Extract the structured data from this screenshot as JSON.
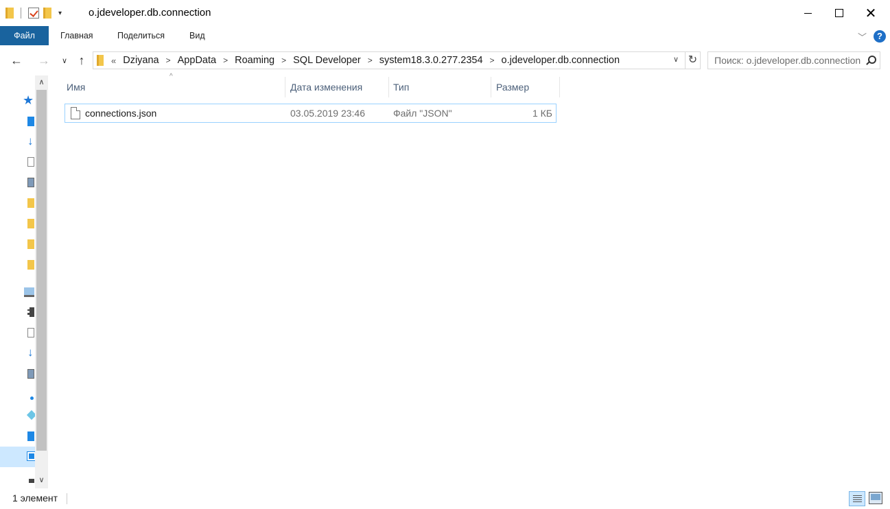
{
  "window": {
    "title": "o.jdeveloper.db.connection"
  },
  "ribbon": {
    "tabs": [
      "Файл",
      "Главная",
      "Поделиться",
      "Вид"
    ],
    "help": "?"
  },
  "address": {
    "overflow": "«",
    "crumbs": [
      "Dziyana",
      "AppData",
      "Roaming",
      "SQL Developer",
      "system18.3.0.277.2354",
      "o.jdeveloper.db.connection"
    ]
  },
  "search": {
    "placeholder": "Поиск: o.jdeveloper.db.connection"
  },
  "columns": {
    "name": "Имя",
    "date": "Дата изменения",
    "type": "Тип",
    "size": "Размер"
  },
  "files": [
    {
      "name": "connections.json",
      "date": "03.05.2019 23:46",
      "type": "Файл \"JSON\"",
      "size": "1 КБ"
    }
  ],
  "status": {
    "count": "1 элемент"
  },
  "colors": {
    "file_tab": "#19639e",
    "selection_border": "#99d1ff",
    "header_text": "#4c607a"
  }
}
